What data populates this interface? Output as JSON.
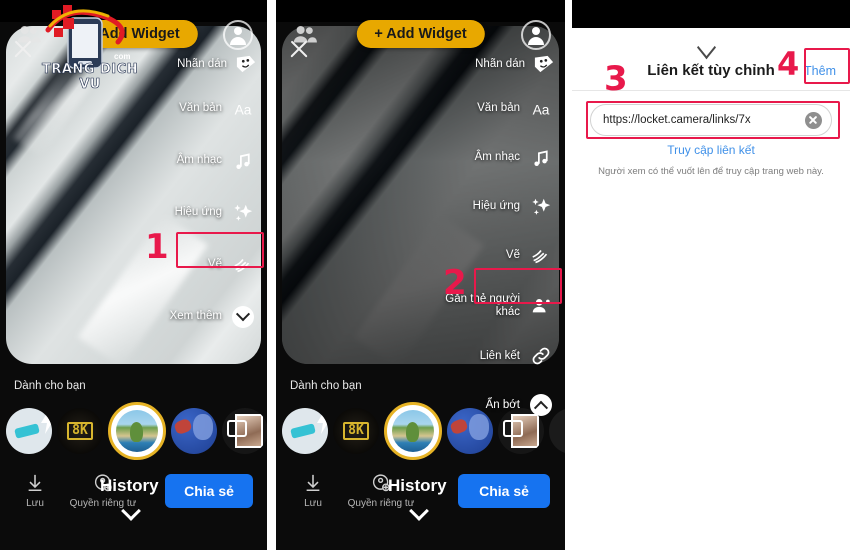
{
  "watermark": {
    "text": "TRANG DICH VU",
    "tld": "com"
  },
  "panel1": {
    "topbar": {
      "close_icon": "close-icon",
      "people_icon": "people-icon",
      "add_widget_label": "+ Add Widget",
      "profile_icon": "profile-icon",
      "sticker_label": "Nhãn dán",
      "sticker_icon": "sticker-icon"
    },
    "menu": [
      {
        "label": "Văn bản",
        "icon": "text-aa-icon"
      },
      {
        "label": "Âm nhạc",
        "icon": "music-note-icon"
      },
      {
        "label": "Hiệu ứng",
        "icon": "sparkles-icon"
      },
      {
        "label": "Vẽ",
        "icon": "squiggle-draw-icon"
      },
      {
        "label": "Xem thêm",
        "icon": "chevron-down-circle-icon"
      }
    ],
    "bottom": {
      "for_you_label": "Dành cho bạn",
      "save_label": "Lưu",
      "privacy_label": "Quyền riêng tư",
      "history_label": "History",
      "share_label": "Chia sẻ"
    },
    "annotation": {
      "number": "1"
    }
  },
  "panel2": {
    "topbar": {
      "close_icon": "close-icon",
      "people_icon": "people-icon",
      "add_widget_label": "+ Add Widget",
      "profile_icon": "profile-icon",
      "sticker_label": "Nhãn dán",
      "sticker_icon": "sticker-icon"
    },
    "menu": [
      {
        "label": "Văn bản",
        "icon": "text-aa-icon"
      },
      {
        "label": "Âm nhạc",
        "icon": "music-note-icon"
      },
      {
        "label": "Hiệu ứng",
        "icon": "sparkles-icon"
      },
      {
        "label": "Vẽ",
        "icon": "squiggle-draw-icon"
      },
      {
        "label": "Gắn thẻ người\nkhác",
        "icon": "tag-person-icon"
      },
      {
        "label": "Liên kết",
        "icon": "link-chain-icon"
      },
      {
        "label": "Ẩn bớt",
        "icon": "chevron-up-circle-icon"
      }
    ],
    "bottom": {
      "for_you_label": "Dành cho bạn",
      "save_label": "Lưu",
      "privacy_label": "Quyền riêng tư",
      "history_label": "History",
      "share_label": "Chia sẻ"
    },
    "annotation": {
      "number": "2"
    }
  },
  "panel3": {
    "grab_icon": "chevron-down-handle-icon",
    "title": "Liên kết tùy chỉnh",
    "add_label": "Thêm",
    "url_value": "https://locket.camera/links/7x",
    "clear_icon": "clear-circle-icon",
    "visit_link_label": "Truy cập liên kết",
    "hint": "Người xem có thể vuốt lên để truy cập trang web này.",
    "annotations": {
      "number3": "3",
      "number4": "4"
    }
  },
  "colors": {
    "accent_red": "#e8194b",
    "share_blue": "#1673f0",
    "widget_yellow": "#e8a800",
    "link_blue": "#3f90e8"
  }
}
